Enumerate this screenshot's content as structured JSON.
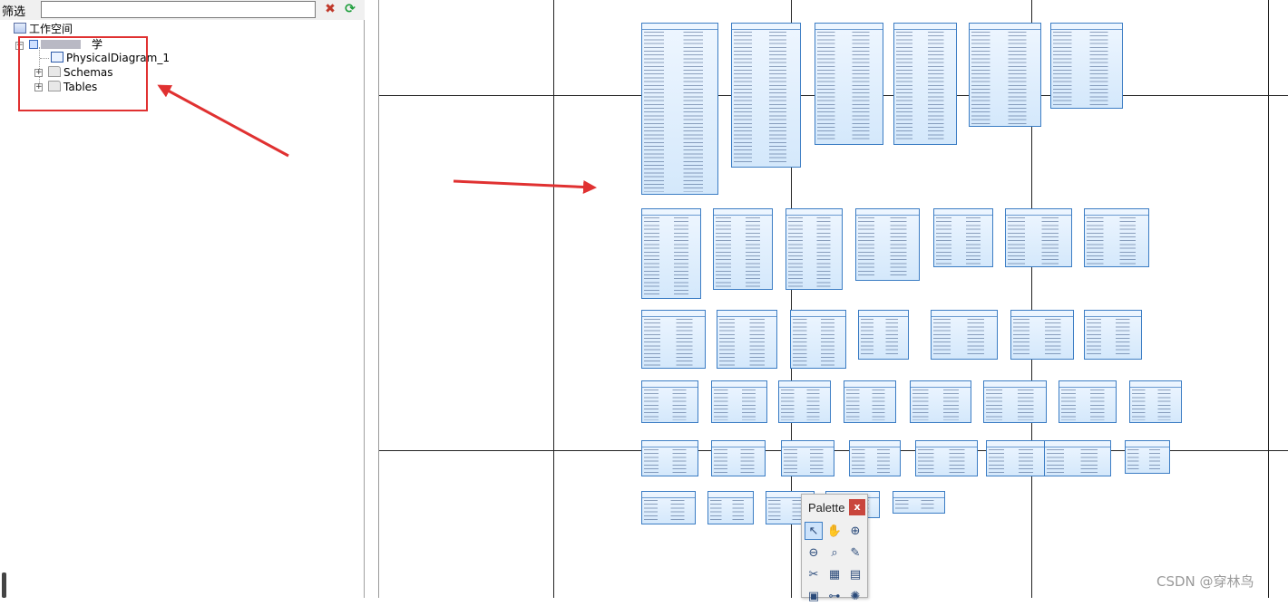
{
  "filter": {
    "label": "筛选",
    "value": ""
  },
  "tree": {
    "workspace_label": "工作空间",
    "model_label": "　学",
    "items": [
      {
        "label": "PhysicalDiagram_1"
      },
      {
        "label": "Schemas"
      },
      {
        "label": "Tables"
      }
    ]
  },
  "icons": {
    "clear_filter": "clear-filter-icon",
    "refresh": "refresh-icon"
  },
  "palette": {
    "title": "Palette",
    "close": "x",
    "tools": [
      {
        "name": "pointer-tool",
        "glyph": "↖",
        "active": true
      },
      {
        "name": "grabber-tool",
        "glyph": "✋"
      },
      {
        "name": "zoom-in-tool",
        "glyph": "⊕"
      },
      {
        "name": "zoom-out-tool",
        "glyph": "⊖"
      },
      {
        "name": "zoom-fit-tool",
        "glyph": "⌕"
      },
      {
        "name": "open-properties-tool",
        "glyph": "✎"
      },
      {
        "name": "delete-tool",
        "glyph": "✂"
      },
      {
        "name": "package-tool",
        "glyph": "▦"
      },
      {
        "name": "table-tool",
        "glyph": "▤"
      },
      {
        "name": "view-tool",
        "glyph": "▣"
      },
      {
        "name": "reference-tool",
        "glyph": "⊶"
      },
      {
        "name": "procedure-tool",
        "glyph": "✺"
      }
    ]
  },
  "accent_colors": {
    "highlight": "#e03131",
    "entity_border": "#3c7dc4",
    "close_button": "#c9463d"
  },
  "watermark": "CSDN @穿林鸟"
}
